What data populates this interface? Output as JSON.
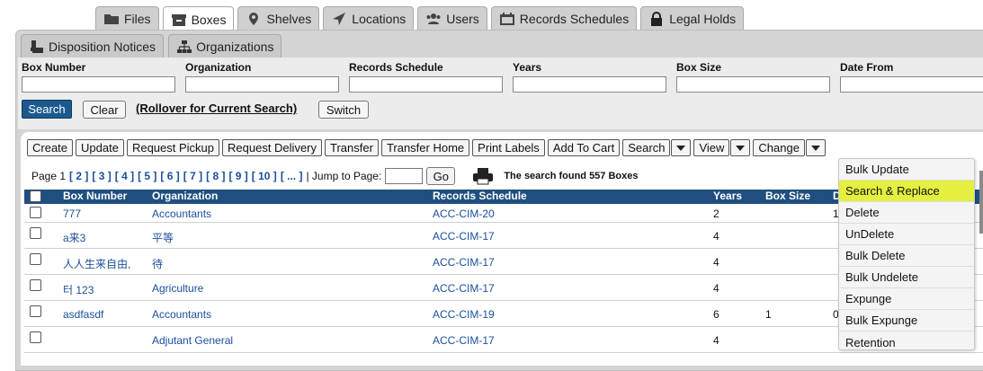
{
  "tabs": [
    {
      "label": "Files",
      "icon": "folder-icon"
    },
    {
      "label": "Boxes",
      "icon": "box-icon",
      "active": true
    },
    {
      "label": "Shelves",
      "icon": "map-pin-icon"
    },
    {
      "label": "Locations",
      "icon": "location-arrow-icon"
    },
    {
      "label": "Users",
      "icon": "users-icon"
    },
    {
      "label": "Records Schedules",
      "icon": "calendar-icon"
    },
    {
      "label": "Legal Holds",
      "icon": "lock-icon"
    }
  ],
  "subtabs": [
    {
      "label": "Disposition Notices",
      "icon": "stamp-icon"
    },
    {
      "label": "Organizations",
      "icon": "org-chart-icon"
    }
  ],
  "search": {
    "fields": [
      "Box Number",
      "Organization",
      "Records Schedule",
      "Years",
      "Box Size",
      "Date From"
    ],
    "search_label": "Search",
    "clear_label": "Clear",
    "rollover_label": "(Rollover for Current Search)",
    "switch_label": "Switch"
  },
  "toolbar": {
    "create": "Create",
    "update": "Update",
    "request_pickup": "Request Pickup",
    "request_delivery": "Request Delivery",
    "transfer": "Transfer",
    "transfer_home": "Transfer Home",
    "print_labels": "Print Labels",
    "add_to_cart": "Add To Cart",
    "search": "Search",
    "view": "View",
    "change": "Change"
  },
  "pager": {
    "page_label": "Page 1",
    "pages": [
      "[ 2 ]",
      "[ 3 ]",
      "[ 4 ]",
      "[ 5 ]",
      "[ 6 ]",
      "[ 7 ]",
      "[ 8 ]",
      "[ 9 ]",
      "[ 10 ]",
      "[ ... ]"
    ],
    "jump_label": "| Jump to Page:",
    "go_label": "Go",
    "found_text": "The search found  557 Boxes"
  },
  "table": {
    "headers": {
      "box_number": "Box Number",
      "organization": "Organization",
      "records_schedule": "Records Schedule",
      "years": "Years",
      "box_size": "Box Size",
      "date": "D"
    },
    "rows": [
      {
        "box": "777",
        "org": "Accountants",
        "sched": "ACC-CIM-20",
        "years": "2",
        "size": "",
        "date": "1"
      },
      {
        "box": "a来3",
        "org": "平等",
        "sched": "ACC-CIM-17",
        "years": "4",
        "size": "",
        "date": ""
      },
      {
        "box": "人人生来自由,",
        "org": "待",
        "sched": "ACC-CIM-17",
        "years": "4",
        "size": "",
        "date": ""
      },
      {
        "box": "터 123",
        "org": "Agriculture",
        "sched": "ACC-CIM-17",
        "years": "4",
        "size": "",
        "date": ""
      },
      {
        "box": "asdfasdf",
        "org": "Accountants",
        "sched": "ACC-CIM-19",
        "years": "6",
        "size": "1",
        "date": "0"
      },
      {
        "box": "",
        "org": "Adjutant General",
        "sched": "ACC-CIM-17",
        "years": "4",
        "size": "",
        "date": ""
      }
    ]
  },
  "change_menu": {
    "items": [
      "Bulk Update",
      "Search & Replace",
      "Delete",
      "UnDelete",
      "Bulk Delete",
      "Bulk Undelete",
      "Expunge",
      "Bulk Expunge",
      "Retention"
    ],
    "highlighted": "Search & Replace",
    "highlight_color": "#e4ef3f"
  },
  "colors": {
    "header_bg": "#1f4f80",
    "link": "#1a4f9c",
    "search_button": "#1c5a8e"
  }
}
